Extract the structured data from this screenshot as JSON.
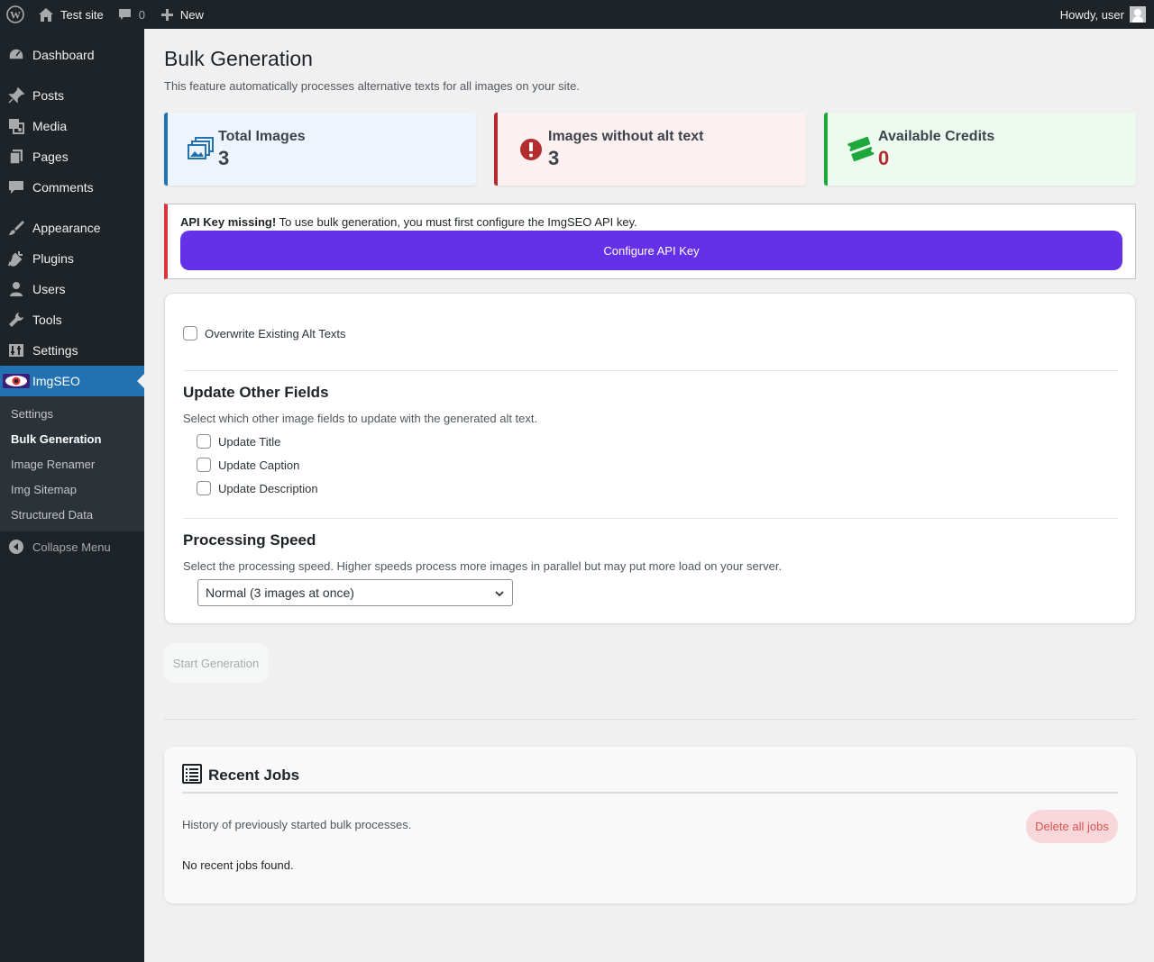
{
  "adminbar": {
    "site_name": "Test site",
    "comments_count": "0",
    "new_label": "New",
    "howdy": "Howdy, user"
  },
  "sidebar": {
    "items": [
      {
        "label": "Dashboard",
        "icon": "dashboard-icon"
      },
      {
        "label": "Posts",
        "icon": "pin-icon"
      },
      {
        "label": "Media",
        "icon": "media-icon"
      },
      {
        "label": "Pages",
        "icon": "pages-icon"
      },
      {
        "label": "Comments",
        "icon": "comment-icon"
      },
      {
        "label": "Appearance",
        "icon": "brush-icon"
      },
      {
        "label": "Plugins",
        "icon": "plug-icon"
      },
      {
        "label": "Users",
        "icon": "user-icon"
      },
      {
        "label": "Tools",
        "icon": "wrench-icon"
      },
      {
        "label": "Settings",
        "icon": "sliders-icon"
      },
      {
        "label": "ImgSEO",
        "icon": "eye-logo-icon"
      }
    ],
    "submenu": [
      "Settings",
      "Bulk Generation",
      "Image Renamer",
      "Img Sitemap",
      "Structured Data"
    ],
    "collapse_label": "Collapse Menu"
  },
  "page": {
    "title": "Bulk Generation",
    "description": "This feature automatically processes alternative texts for all images on your site."
  },
  "stats": [
    {
      "label": "Total Images",
      "value": "3",
      "icon": "images-icon",
      "accent": "#2271b1",
      "bg": "#eef4fc",
      "value_color": "#3c434a"
    },
    {
      "label": "Images without alt text",
      "value": "3",
      "icon": "alert-icon",
      "accent": "#b32d2e",
      "bg": "#fcf0f1",
      "value_color": "#3c434a"
    },
    {
      "label": "Available Credits",
      "value": "0",
      "icon": "tickets-icon",
      "accent": "#1ea83b",
      "bg": "#edfaef",
      "value_color": "#b32d2e"
    }
  ],
  "notice": {
    "strong": "API Key missing!",
    "text": " To use bulk generation, you must first configure the ImgSEO API key.",
    "button": "Configure API Key"
  },
  "options": {
    "overwrite_label": "Overwrite Existing Alt Texts",
    "update_title": "Update Other Fields",
    "update_desc": "Select which other image fields to update with the generated alt text.",
    "update_fields": [
      "Update Title",
      "Update Caption",
      "Update Description"
    ],
    "speed_title": "Processing Speed",
    "speed_desc": "Select the processing speed. Higher speeds process more images in parallel but may put more load on your server.",
    "speed_value": "Normal (3 images at once)"
  },
  "start_button": "Start Generation",
  "jobs": {
    "title": "Recent Jobs",
    "description": "History of previously started bulk processes.",
    "delete_button": "Delete all jobs",
    "empty": "No recent jobs found."
  }
}
